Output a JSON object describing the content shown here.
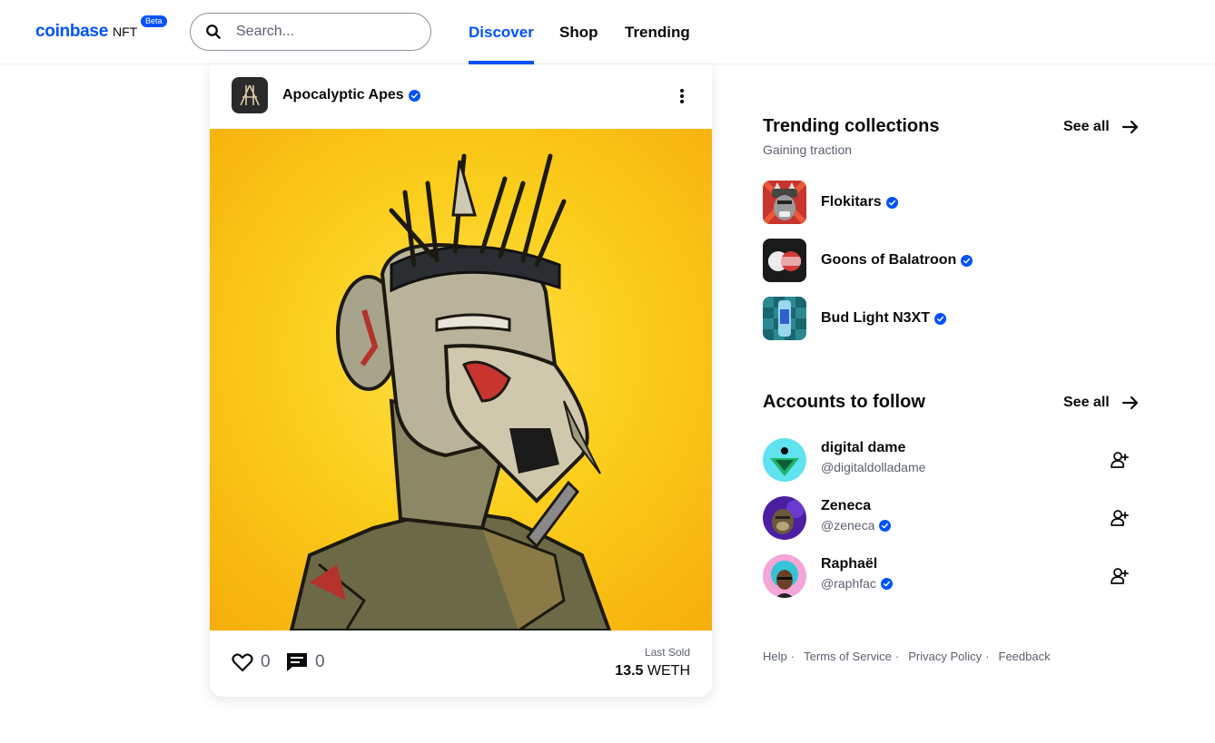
{
  "header": {
    "logo_text": "coinbase",
    "logo_suffix": "NFT",
    "beta_badge": "Beta",
    "search_placeholder": "Search...",
    "nav": [
      {
        "label": "Discover",
        "active": true
      },
      {
        "label": "Shop",
        "active": false
      },
      {
        "label": "Trending",
        "active": false
      }
    ]
  },
  "post": {
    "collection_name": "Apocalyptic Apes",
    "verified": true,
    "image_subject": "zombie ape wearing spiked headband on yellow background",
    "likes": "0",
    "comments": "0",
    "last_sold_label": "Last Sold",
    "price_amount": "13.5",
    "price_currency": "WETH"
  },
  "trending": {
    "title": "Trending collections",
    "subtitle": "Gaining traction",
    "see_all": "See all",
    "items": [
      {
        "name": "Flokitars",
        "verified": true
      },
      {
        "name": "Goons of Balatroon",
        "verified": true
      },
      {
        "name": "Bud Light N3XT",
        "verified": true
      }
    ]
  },
  "accounts": {
    "title": "Accounts to follow",
    "see_all": "See all",
    "items": [
      {
        "name": "digital dame",
        "handle": "@digitaldolladame",
        "verified": false
      },
      {
        "name": "Zeneca",
        "handle": "@zeneca",
        "verified": true
      },
      {
        "name": "Raphaël",
        "handle": "@raphfac",
        "verified": true
      }
    ]
  },
  "footer": {
    "links": [
      "Help",
      "Terms of Service",
      "Privacy Policy",
      "Feedback"
    ],
    "separator": "·"
  },
  "colors": {
    "brand": "#0052ff",
    "text_primary": "#0a0b0d",
    "text_secondary": "#5b616e",
    "nft_background": "#fbce1c"
  },
  "icons": {
    "search": "search-icon",
    "verified": "verified-badge-icon",
    "more": "kebab-menu-icon",
    "like": "heart-icon",
    "comment": "comment-icon",
    "arrow": "arrow-right-icon",
    "follow": "add-person-icon"
  }
}
